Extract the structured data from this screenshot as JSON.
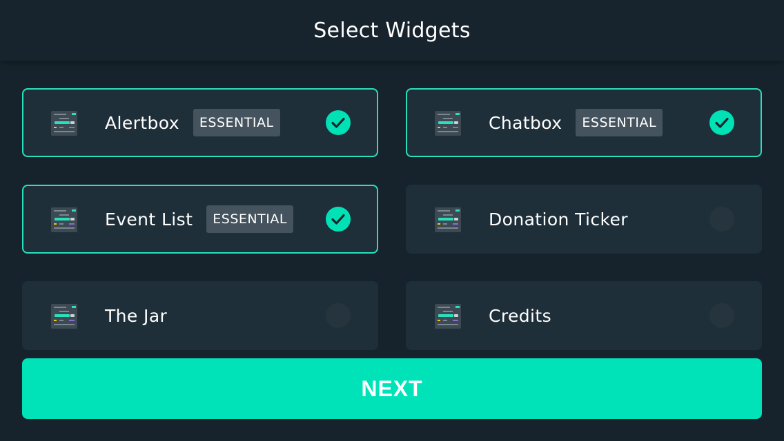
{
  "header": {
    "title": "Select Widgets"
  },
  "widgets": [
    {
      "label": "Alertbox",
      "badge": "ESSENTIAL",
      "selected": true
    },
    {
      "label": "Chatbox",
      "badge": "ESSENTIAL",
      "selected": true
    },
    {
      "label": "Event List",
      "badge": "ESSENTIAL",
      "selected": true
    },
    {
      "label": "Donation Ticker",
      "selected": false
    },
    {
      "label": "The Jar",
      "selected": false
    },
    {
      "label": "Credits",
      "selected": false
    }
  ],
  "footer": {
    "next_label": "NEXT"
  },
  "colors": {
    "accent": "#00e3b8",
    "background": "#17232c",
    "card": "#1f2f3a",
    "badge": "#44535e"
  },
  "icons": {
    "widget": "widget-layout-icon",
    "selected": "checkmark-icon",
    "unselected": "empty-circle-icon"
  }
}
